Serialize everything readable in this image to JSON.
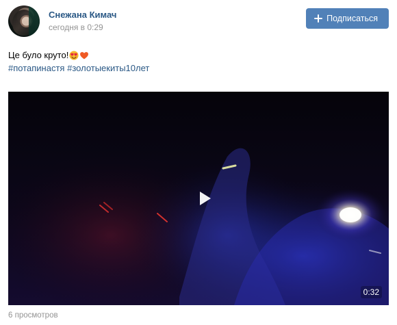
{
  "post": {
    "author_name": "Снежана Кимач",
    "time": "сегодня в 0:29",
    "subscribe_label": "Подписаться",
    "text": "Це було круто!",
    "emojis": [
      "heart-eyes-emoji",
      "heart-emoji"
    ],
    "hashtags": [
      "#потапинастя",
      "#золотыекиты10лет"
    ],
    "video": {
      "duration": "0:32",
      "play_icon": "play-icon"
    },
    "views": "6 просмотров"
  },
  "colors": {
    "link": "#2a5885",
    "button": "#5181b8",
    "meta": "#939393",
    "video_bg": "#05040a"
  }
}
